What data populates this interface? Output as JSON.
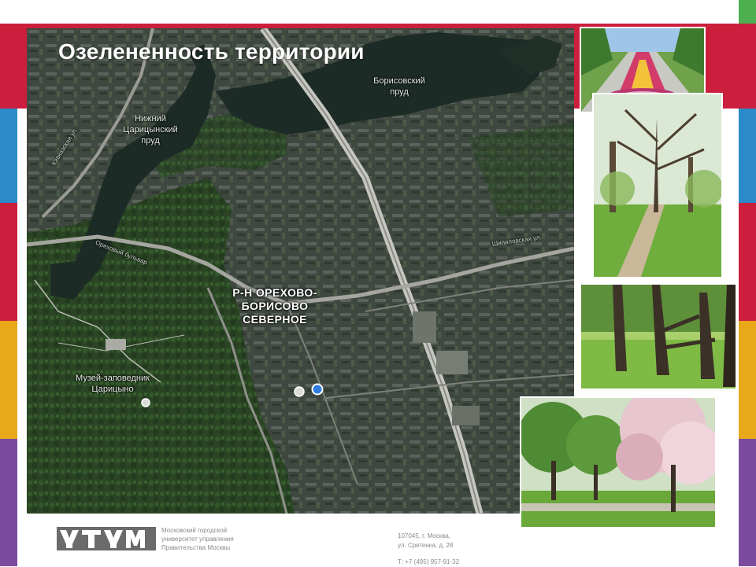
{
  "slide": {
    "title": "Озелененность территории"
  },
  "map": {
    "labels": {
      "borisovsky_pond": "Борисовский\nпруд",
      "lower_tsaritsyno_pond": "Нижний\nЦарицынский\nпруд",
      "district": "Р-Н ОРЕХОВО-БОРИСОВО\nСЕВЕРНОЕ",
      "museum": "Музей-заповедник\nЦарицыно",
      "street_left": "Кавказская ул.",
      "street_mid": "Ореховый бульвар",
      "street_right": "Шипиловская ул."
    },
    "colors": {
      "water": "#1d2b26",
      "forest": "#2c4a26",
      "urban": "#3d463e",
      "road": "#c7c7c2",
      "marker": "#2f7de1"
    }
  },
  "photos": [
    {
      "subject": "flower alley"
    },
    {
      "subject": "oak trees with path"
    },
    {
      "subject": "old trees in park"
    },
    {
      "subject": "blossoming apple trees"
    }
  ],
  "footer": {
    "university": "Московский городской\nуниверситет управления\nПравительства Москвы",
    "address": "107045, г. Москва,\nул. Сретенка, д. 28",
    "phone": "Т: +7 (495) 957-91-32"
  },
  "theme": {
    "accent_red": "#cc1f3d",
    "stripe_colors_left": [
      "#cc1f3d",
      "#2a8bc8",
      "#cc1f3d",
      "#e8a81a",
      "#7b4b9e"
    ],
    "stripe_colors_right": [
      "#4caf50",
      "#cc1f3d",
      "#2a8bc8",
      "#cc1f3d",
      "#e8a81a",
      "#7b4b9e"
    ]
  }
}
